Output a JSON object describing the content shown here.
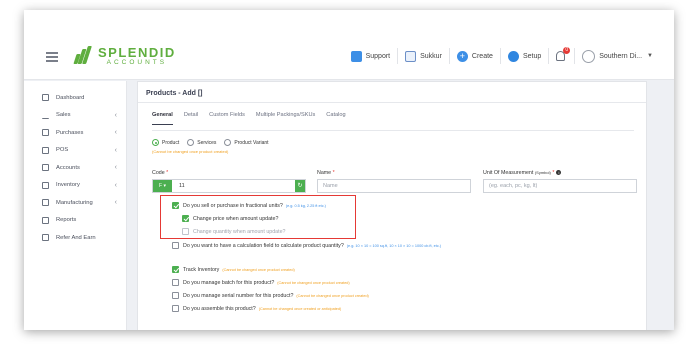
{
  "header": {
    "logo_title": "SPLENDID",
    "logo_subtitle": "ACCOUNTS",
    "support_label": "Support",
    "branch_label": "Sukkur",
    "create_label": "Create",
    "setup_label": "Setup",
    "notification_count": "0",
    "user_label": "Southern Di..."
  },
  "sidebar": {
    "items": [
      {
        "label": "Dashboard"
      },
      {
        "label": "Sales"
      },
      {
        "label": "Purchases"
      },
      {
        "label": "POS"
      },
      {
        "label": "Accounts"
      },
      {
        "label": "Inventory"
      },
      {
        "label": "Manufacturing"
      },
      {
        "label": "Reports"
      },
      {
        "label": "Refer And Earn"
      }
    ]
  },
  "page": {
    "title": "Products - Add []",
    "tabs": [
      "General",
      "Detail",
      "Custom Fields",
      "Multiple Packings/SKUs",
      "Catalog"
    ],
    "active_tab": "General"
  },
  "form": {
    "type_options": [
      "Product",
      "Services",
      "Product Variant"
    ],
    "type_note": "(Cannot be changed once product created)",
    "code_label": "Code",
    "code_value": "11",
    "code_button": "F",
    "name_label": "Name",
    "name_placeholder": "Name",
    "uom_label": "Unit Of Measurement",
    "uom_sublabel": "(Symbol)",
    "uom_placeholder": "(eg. each, pc, kg, lt)",
    "fractional_label": "Do you sell or purchase in fractional units?",
    "fractional_hint": "(e.g. 0.5 kg, 2.25 ft etc.)",
    "change_price_label": "Change price when amount update?",
    "change_qty_label": "Change quantity when amount update?",
    "calc_label": "Do you want to have a calculation field to calculate product quantity?",
    "calc_hint": "(e.g. 10 × 10 = 100 sq.ft, 10 × 10 × 10 = 1000 cb.ft, etc.)",
    "track_label": "Track Inventory",
    "track_note": "(Cannot be changed once product created)",
    "batch_label": "Do you manage batch for this product?",
    "batch_note": "(Cannot be changed once product created)",
    "serial_label": "Do you manage serial number for this product?",
    "serial_note": "(Cannot be changed once product created)",
    "assemble_label": "Do you assemble this product?",
    "assemble_note": "(Cannot be changed once created or anticipated)"
  },
  "colors": {
    "brand_green": "#5fae3e",
    "accent_green": "#4caf50",
    "highlight_red": "#e53935",
    "link_blue": "#3d8fe6",
    "warning_orange": "#f0a020"
  }
}
